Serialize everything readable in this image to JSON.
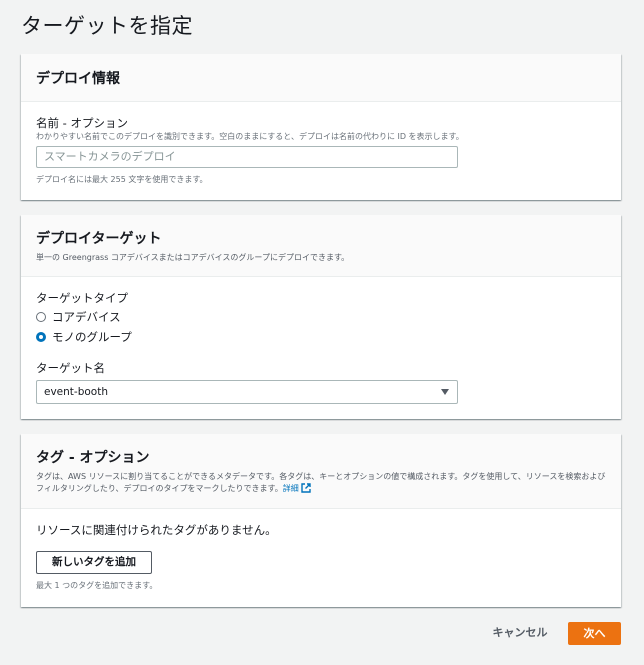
{
  "page": {
    "title": "ターゲットを指定"
  },
  "deploy_info": {
    "title": "デプロイ情報",
    "name_label": "名前 - オプション",
    "name_desc": "わかりやすい名前でこのデプロイを識別できます。空白のままにすると、デプロイは名前の代わりに ID を表示します。",
    "name_placeholder": "スマートカメラのデプロイ",
    "name_hint": "デプロイ名には最大 255 文字を使用できます。"
  },
  "deploy_target": {
    "title": "デプロイターゲット",
    "desc": "単一の Greengrass コアデバイスまたはコアデバイスのグループにデプロイできます。",
    "type_label": "ターゲットタイプ",
    "options": [
      {
        "label": "コアデバイス",
        "checked": false
      },
      {
        "label": "モノのグループ",
        "checked": true
      }
    ],
    "target_name_label": "ターゲット名",
    "target_name_value": "event-booth"
  },
  "tags": {
    "title": "タグ - オプション",
    "desc": "タグは、AWS リソースに割り当てることができるメタデータです。各タグは、キーとオプションの値で構成されます。タグを使用して、リソースを検索およびフィルタリングしたり、デプロイのタイプをマークしたりできます。",
    "link": "詳細",
    "empty": "リソースに関連付けられたタグがありません。",
    "add_button": "新しいタグを追加",
    "limit_hint": "最大 1 つのタグを追加できます。"
  },
  "footer": {
    "cancel": "キャンセル",
    "next": "次へ"
  },
  "colors": {
    "primary": "#ec7211",
    "link": "#0073bb",
    "radio_checked": "#0073bb",
    "background": "#f2f3f3"
  }
}
